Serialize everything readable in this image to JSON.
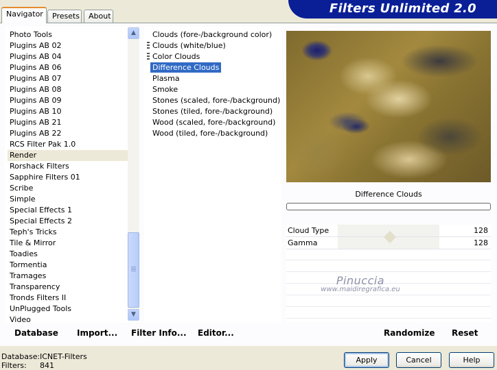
{
  "tabs": [
    {
      "label": "Navigator",
      "active": true
    },
    {
      "label": "Presets",
      "active": false
    },
    {
      "label": "About",
      "active": false
    }
  ],
  "app_title": "Filters Unlimited 2.0",
  "categories": [
    "Photo Tools",
    "Plugins AB 02",
    "Plugins AB 04",
    "Plugins AB 06",
    "Plugins AB 07",
    "Plugins AB 08",
    "Plugins AB 09",
    "Plugins AB 10",
    "Plugins AB 21",
    "Plugins AB 22",
    "RCS Filter Pak 1.0",
    "Render",
    "Rorshack Filters",
    "Sapphire Filters 01",
    "Scribe",
    "Simple",
    "Special Effects 1",
    "Special Effects 2",
    "Teph's Tricks",
    "Tile & Mirror",
    "Toadies",
    "Tormentia",
    "Tramages",
    "Transparency",
    "Tronds Filters II",
    "UnPlugged Tools",
    "Video"
  ],
  "selected_category": "Render",
  "filters": [
    {
      "label": "Clouds (fore-/background color)",
      "grip": false
    },
    {
      "label": "Clouds (white/blue)",
      "grip": true
    },
    {
      "label": "Color Clouds",
      "grip": true
    },
    {
      "label": "Difference Clouds",
      "grip": false,
      "selected": true
    },
    {
      "label": "Plasma",
      "grip": false
    },
    {
      "label": "Smoke",
      "grip": false
    },
    {
      "label": "Stones (scaled, fore-/background)",
      "grip": false
    },
    {
      "label": "Stones (tiled, fore-/background)",
      "grip": false
    },
    {
      "label": "Wood (scaled, fore-/background)",
      "grip": false
    },
    {
      "label": "Wood (tiled, fore-/background)",
      "grip": false
    }
  ],
  "preview": {
    "filter_name": "Difference Clouds"
  },
  "params": [
    {
      "label": "Cloud Type",
      "value": "128"
    },
    {
      "label": "Gamma",
      "value": "128"
    }
  ],
  "watermark": {
    "line1": "Pinuccia",
    "line2": "www.maidiregrafica.eu"
  },
  "toolbar": {
    "database": "Database",
    "import": "Import...",
    "filter_info": "Filter Info...",
    "editor": "Editor...",
    "randomize": "Randomize",
    "reset": "Reset"
  },
  "footer": {
    "database_key": "Database:",
    "database_value": "ICNET-Filters",
    "filters_key": "Filters:",
    "filters_value": "841"
  },
  "buttons": {
    "apply": "Apply",
    "cancel": "Cancel",
    "help": "Help"
  }
}
